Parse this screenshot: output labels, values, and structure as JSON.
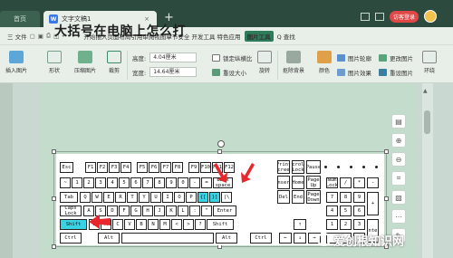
{
  "titlebar": {
    "home_tab": "首页",
    "doc_tab": "文字文稿1",
    "doc_badge": "W",
    "close_glyph": "×",
    "newtab_glyph": "+",
    "user_label": "访客登录"
  },
  "menu": {
    "file": "三 文件",
    "tabs_text": "开始插入页面布局引用审阅视图章节安全 开发工具 特色应用",
    "active_tab": "图片工具",
    "search": "Q 查找"
  },
  "ribbon": {
    "insert_pic": "插入图片",
    "shape": "形状",
    "compress": "压缩图片",
    "crop": "裁剪",
    "height_label": "高度:",
    "height_value": "4.04厘米",
    "width_label": "宽度:",
    "width_value": "14.64厘米",
    "lock_ratio": "锁定纵横比",
    "reset_size": "重设大小",
    "rotate": "旋转",
    "remove_bg": "抠除背景",
    "color": "颜色",
    "pic_outline": "图片轮廓",
    "pic_effect": "图片效果",
    "change_pic": "更改图片",
    "reset_pic": "重设图片",
    "wrap": "环绕"
  },
  "document": {
    "heading": "大括号在电脑上怎么打"
  },
  "keyboard": {
    "row0": [
      "Esc",
      "F1",
      "F2",
      "F3",
      "F4",
      "F5",
      "F6",
      "F7",
      "F8",
      "F9",
      "F10",
      "F11",
      "F12",
      "Print Screen",
      "Scroll Lock",
      "Pause"
    ],
    "row1": [
      "~",
      "1",
      "2",
      "3",
      "4",
      "5",
      "6",
      "7",
      "8",
      "9",
      "0",
      "-",
      "=",
      "Back space",
      "Insert",
      "Home",
      "Page Up",
      "Num Lock",
      "/",
      "*",
      "-"
    ],
    "row2": [
      "Tab",
      "Q",
      "W",
      "E",
      "R",
      "T",
      "Y",
      "U",
      "I",
      "O",
      "P",
      "{[",
      "}]",
      "|\\",
      "Del",
      "End",
      "Page Down",
      "7",
      "8",
      "9",
      "+"
    ],
    "row3": [
      "Caps Lock",
      "A",
      "S",
      "D",
      "F",
      "G",
      "H",
      "J",
      "K",
      "L",
      ":",
      "\"",
      "Enter",
      "4",
      "5",
      "6"
    ],
    "row4": [
      "Shift",
      "Z",
      "X",
      "C",
      "V",
      "B",
      "N",
      "M",
      "<",
      ">",
      "?",
      "Shift",
      "↑",
      "1",
      "2",
      "3",
      "Enter"
    ],
    "row5": [
      "Ctrl",
      "Alt",
      "Alt",
      "Ctrl",
      "←",
      "↓",
      "→",
      "0",
      "."
    ]
  },
  "watermark": "爱创根知识网",
  "colors": {
    "accent": "#2e7c5a",
    "key_highlight": "#39d3e3",
    "arrow": "#e8262b"
  }
}
